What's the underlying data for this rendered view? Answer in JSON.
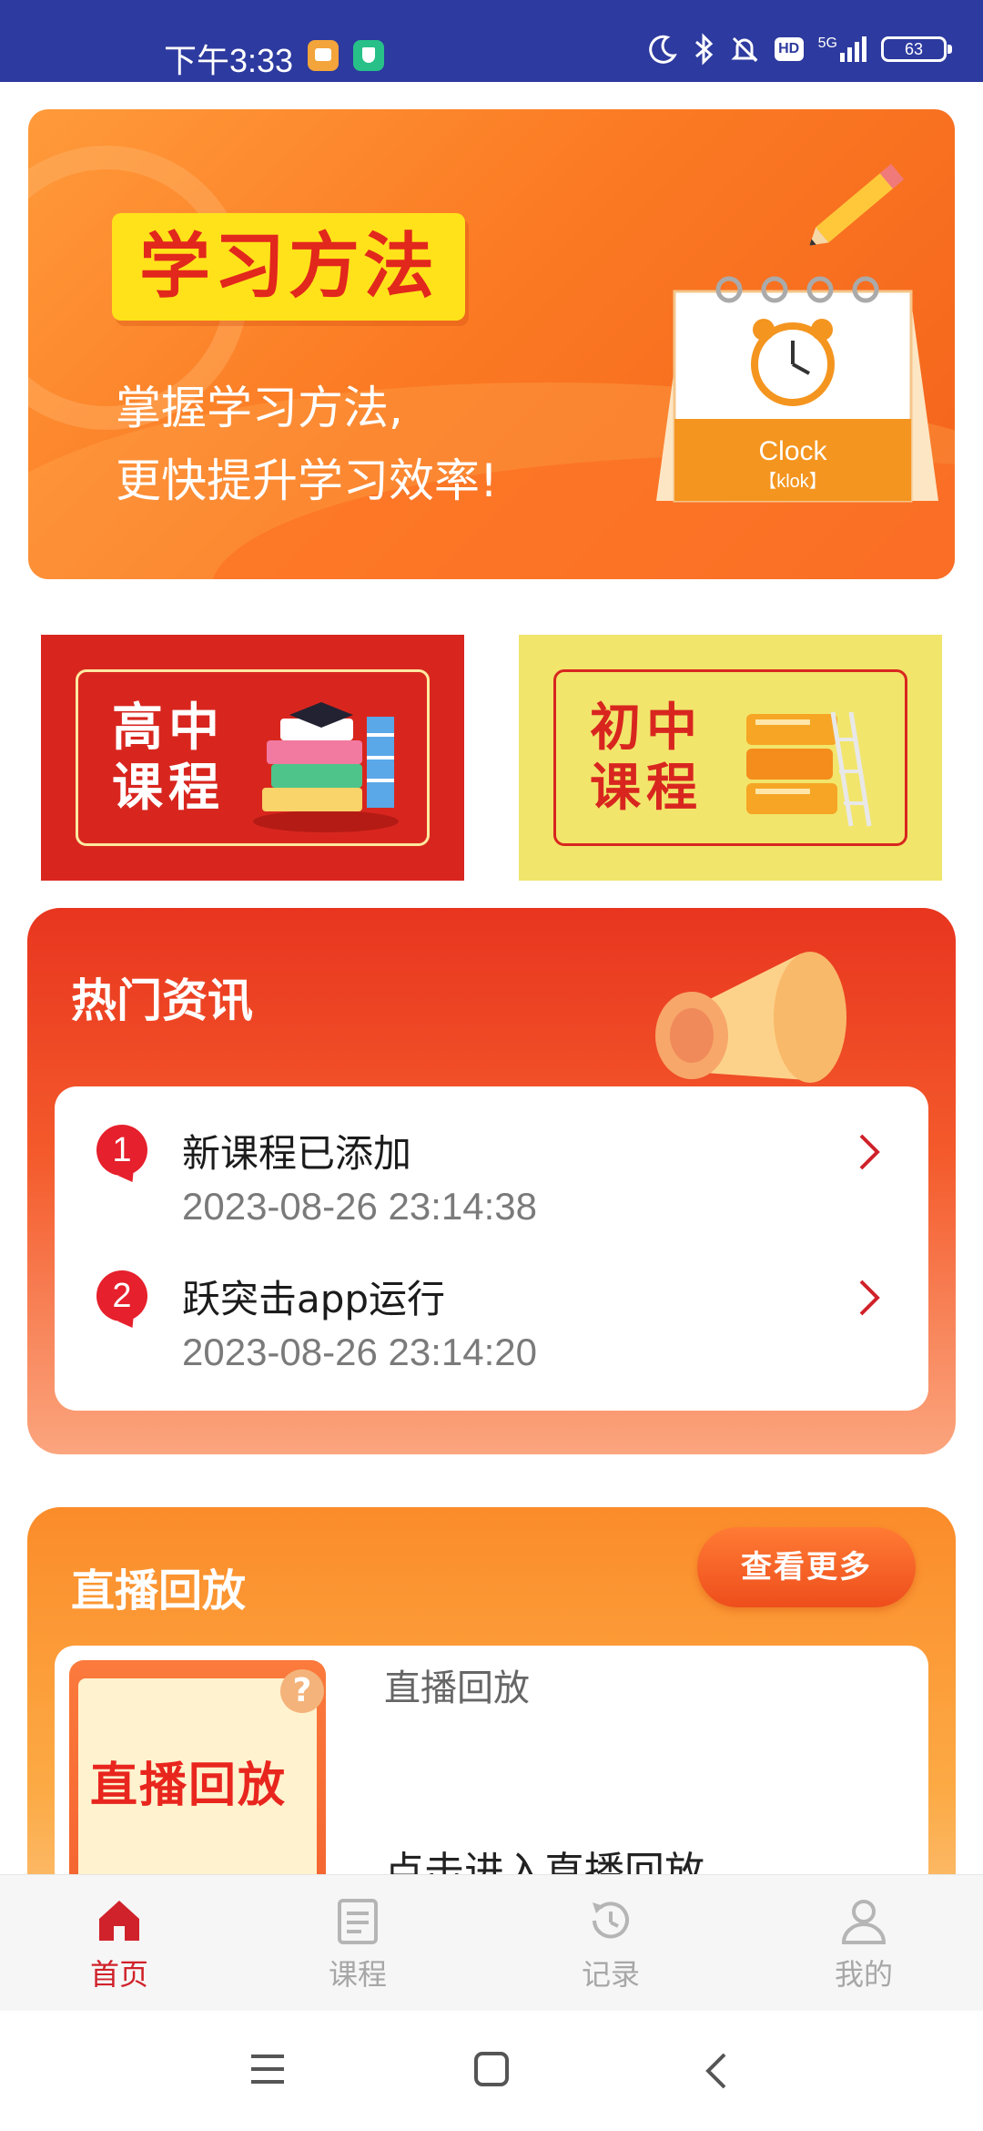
{
  "status_bar": {
    "time": "下午3:33",
    "network": "5G",
    "hd": "HD",
    "battery": "63"
  },
  "banner": {
    "tag": "学习方法",
    "line1": "掌握学习方法,",
    "line2": "更快提升学习效率!",
    "calendar_word": "Clock",
    "calendar_phonetic": "【klok】"
  },
  "courses": {
    "high_line1": "高中",
    "high_line2": "课程",
    "mid_line1": "初中",
    "mid_line2": "课程"
  },
  "news": {
    "title": "热门资讯",
    "items": [
      {
        "index": "1",
        "title": "新课程已添加",
        "time": "2023-08-26 23:14:38"
      },
      {
        "index": "2",
        "title": "跃突击app运行",
        "time": "2023-08-26 23:14:20"
      }
    ]
  },
  "live": {
    "title": "直播回放",
    "more_label": "查看更多",
    "thumb_text": "直播回放",
    "item_name": "直播回放",
    "item_desc": "点击进入直播回放"
  },
  "tabbar": {
    "tabs": [
      {
        "label": "首页",
        "icon": "home-icon",
        "active": true
      },
      {
        "label": "课程",
        "icon": "course-icon",
        "active": false
      },
      {
        "label": "记录",
        "icon": "history-icon",
        "active": false
      },
      {
        "label": "我的",
        "icon": "user-icon",
        "active": false
      }
    ]
  },
  "colors": {
    "status_bar": "#2d3a9f",
    "accent_red": "#d0222a",
    "banner_orange": "#fb7a23",
    "card_yellow": "#f2e56c"
  }
}
